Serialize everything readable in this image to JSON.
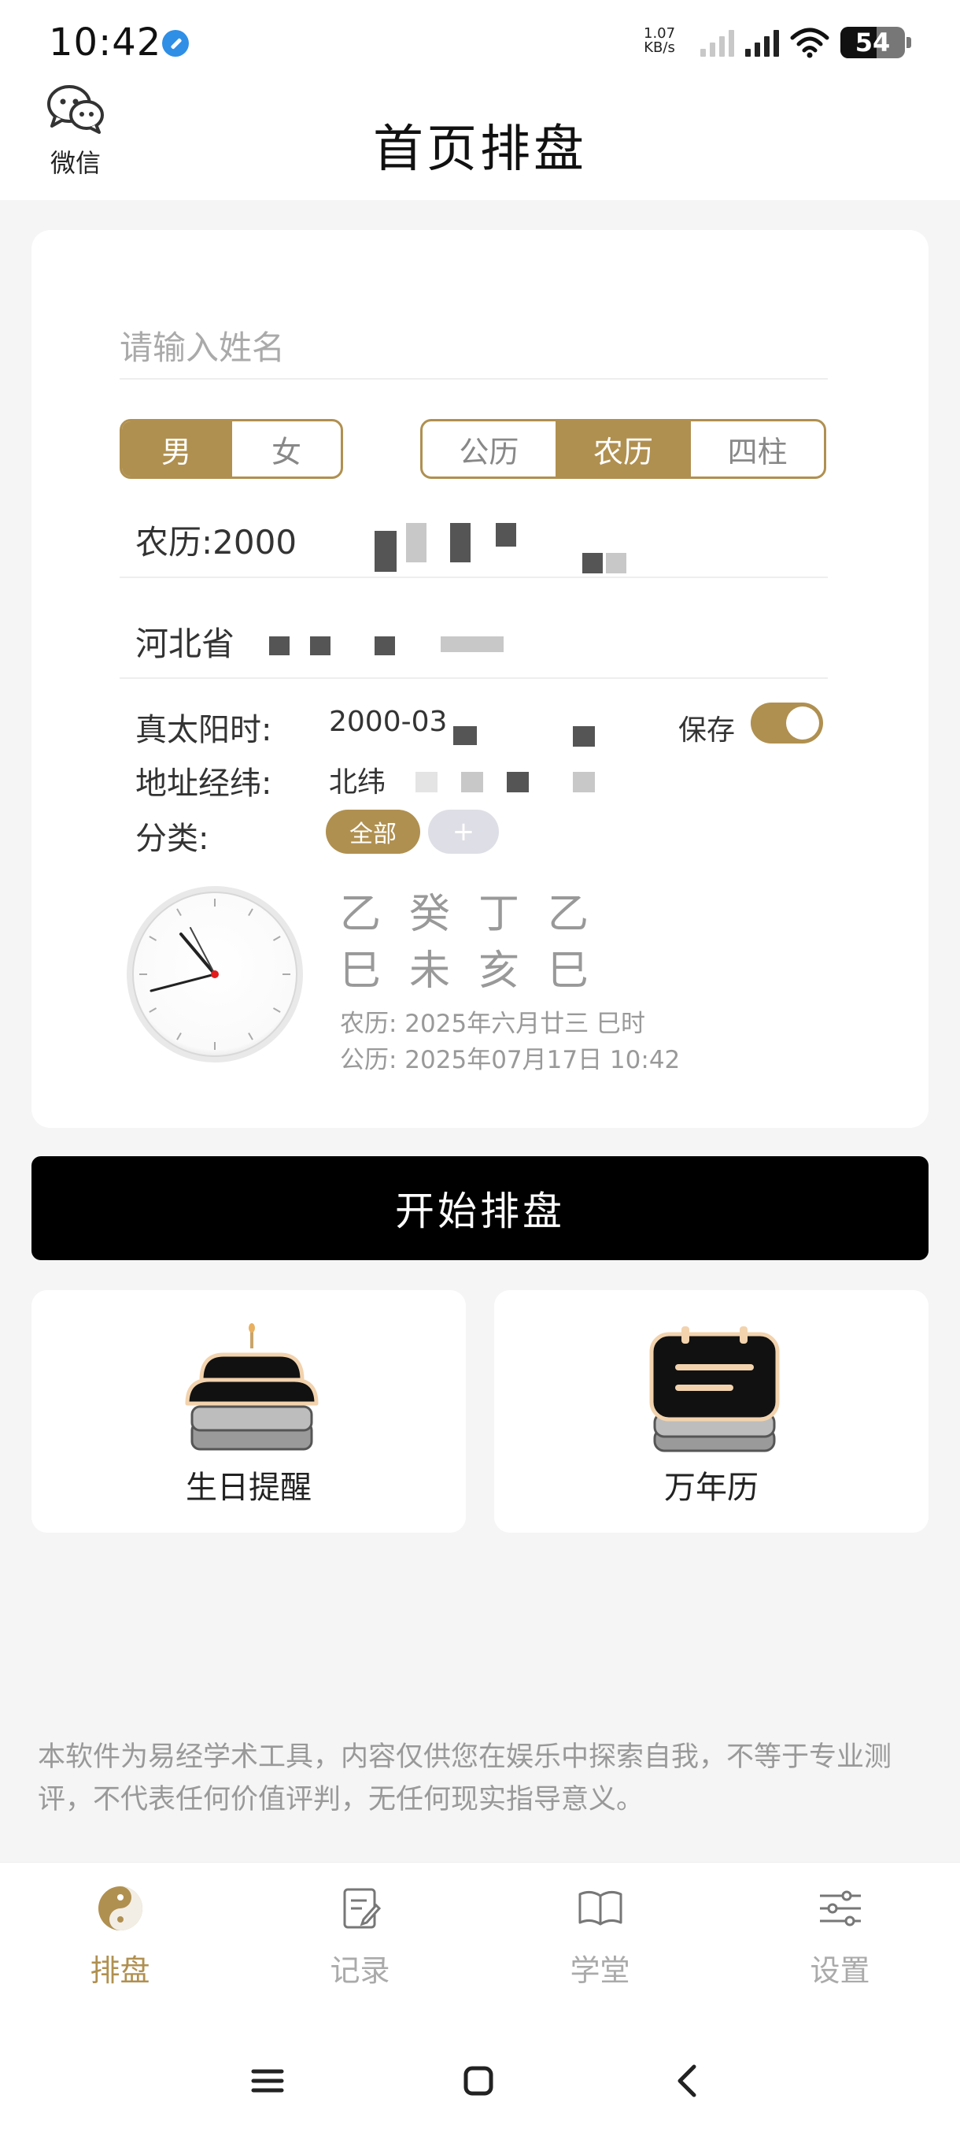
{
  "status_bar": {
    "time": "10:42",
    "net_speed_top": "1.07",
    "net_speed_bottom": "KB/s",
    "battery": "54"
  },
  "header": {
    "wechat_label": "微信",
    "title": "首页排盘"
  },
  "form": {
    "name_placeholder": "请输入姓名",
    "gender_options": [
      "男",
      "女"
    ],
    "gender_selected": "男",
    "calendar_options": [
      "公历",
      "农历",
      "四柱"
    ],
    "calendar_selected": "农历",
    "birth_value": "农历:2000",
    "place_value": "河北省",
    "solar_time_label": "真太阳时:",
    "solar_time_value": "2000-03",
    "coord_label": "地址经纬:",
    "coord_value": "北纬",
    "save_label": "保存",
    "save_enabled": true,
    "category_label": "分类:",
    "category_all": "全部",
    "category_add": "+"
  },
  "bazi": {
    "stems": "乙癸丁乙",
    "branches": "巳未亥巳",
    "lunar_line": "农历: 2025年六月廿三 巳时",
    "solar_line": "公历: 2025年07月17日 10:42"
  },
  "start_button": "开始排盘",
  "tiles": [
    {
      "label": "生日提醒",
      "icon": "cake-icon"
    },
    {
      "label": "万年历",
      "icon": "calendar-icon"
    }
  ],
  "disclaimer": "本软件为易经学术工具，内容仅供您在娱乐中探索自我，不等于专业测评，不代表任何价值评判，无任何现实指导意义。",
  "tabbar": [
    {
      "label": "排盘",
      "icon": "yin-yang-icon",
      "active": true
    },
    {
      "label": "记录",
      "icon": "notes-icon",
      "active": false
    },
    {
      "label": "学堂",
      "icon": "book-icon",
      "active": false
    },
    {
      "label": "设置",
      "icon": "sliders-icon",
      "active": false
    }
  ],
  "colors": {
    "accent": "#b09050",
    "primary_button": "#000000",
    "background": "#f5f5f5"
  }
}
